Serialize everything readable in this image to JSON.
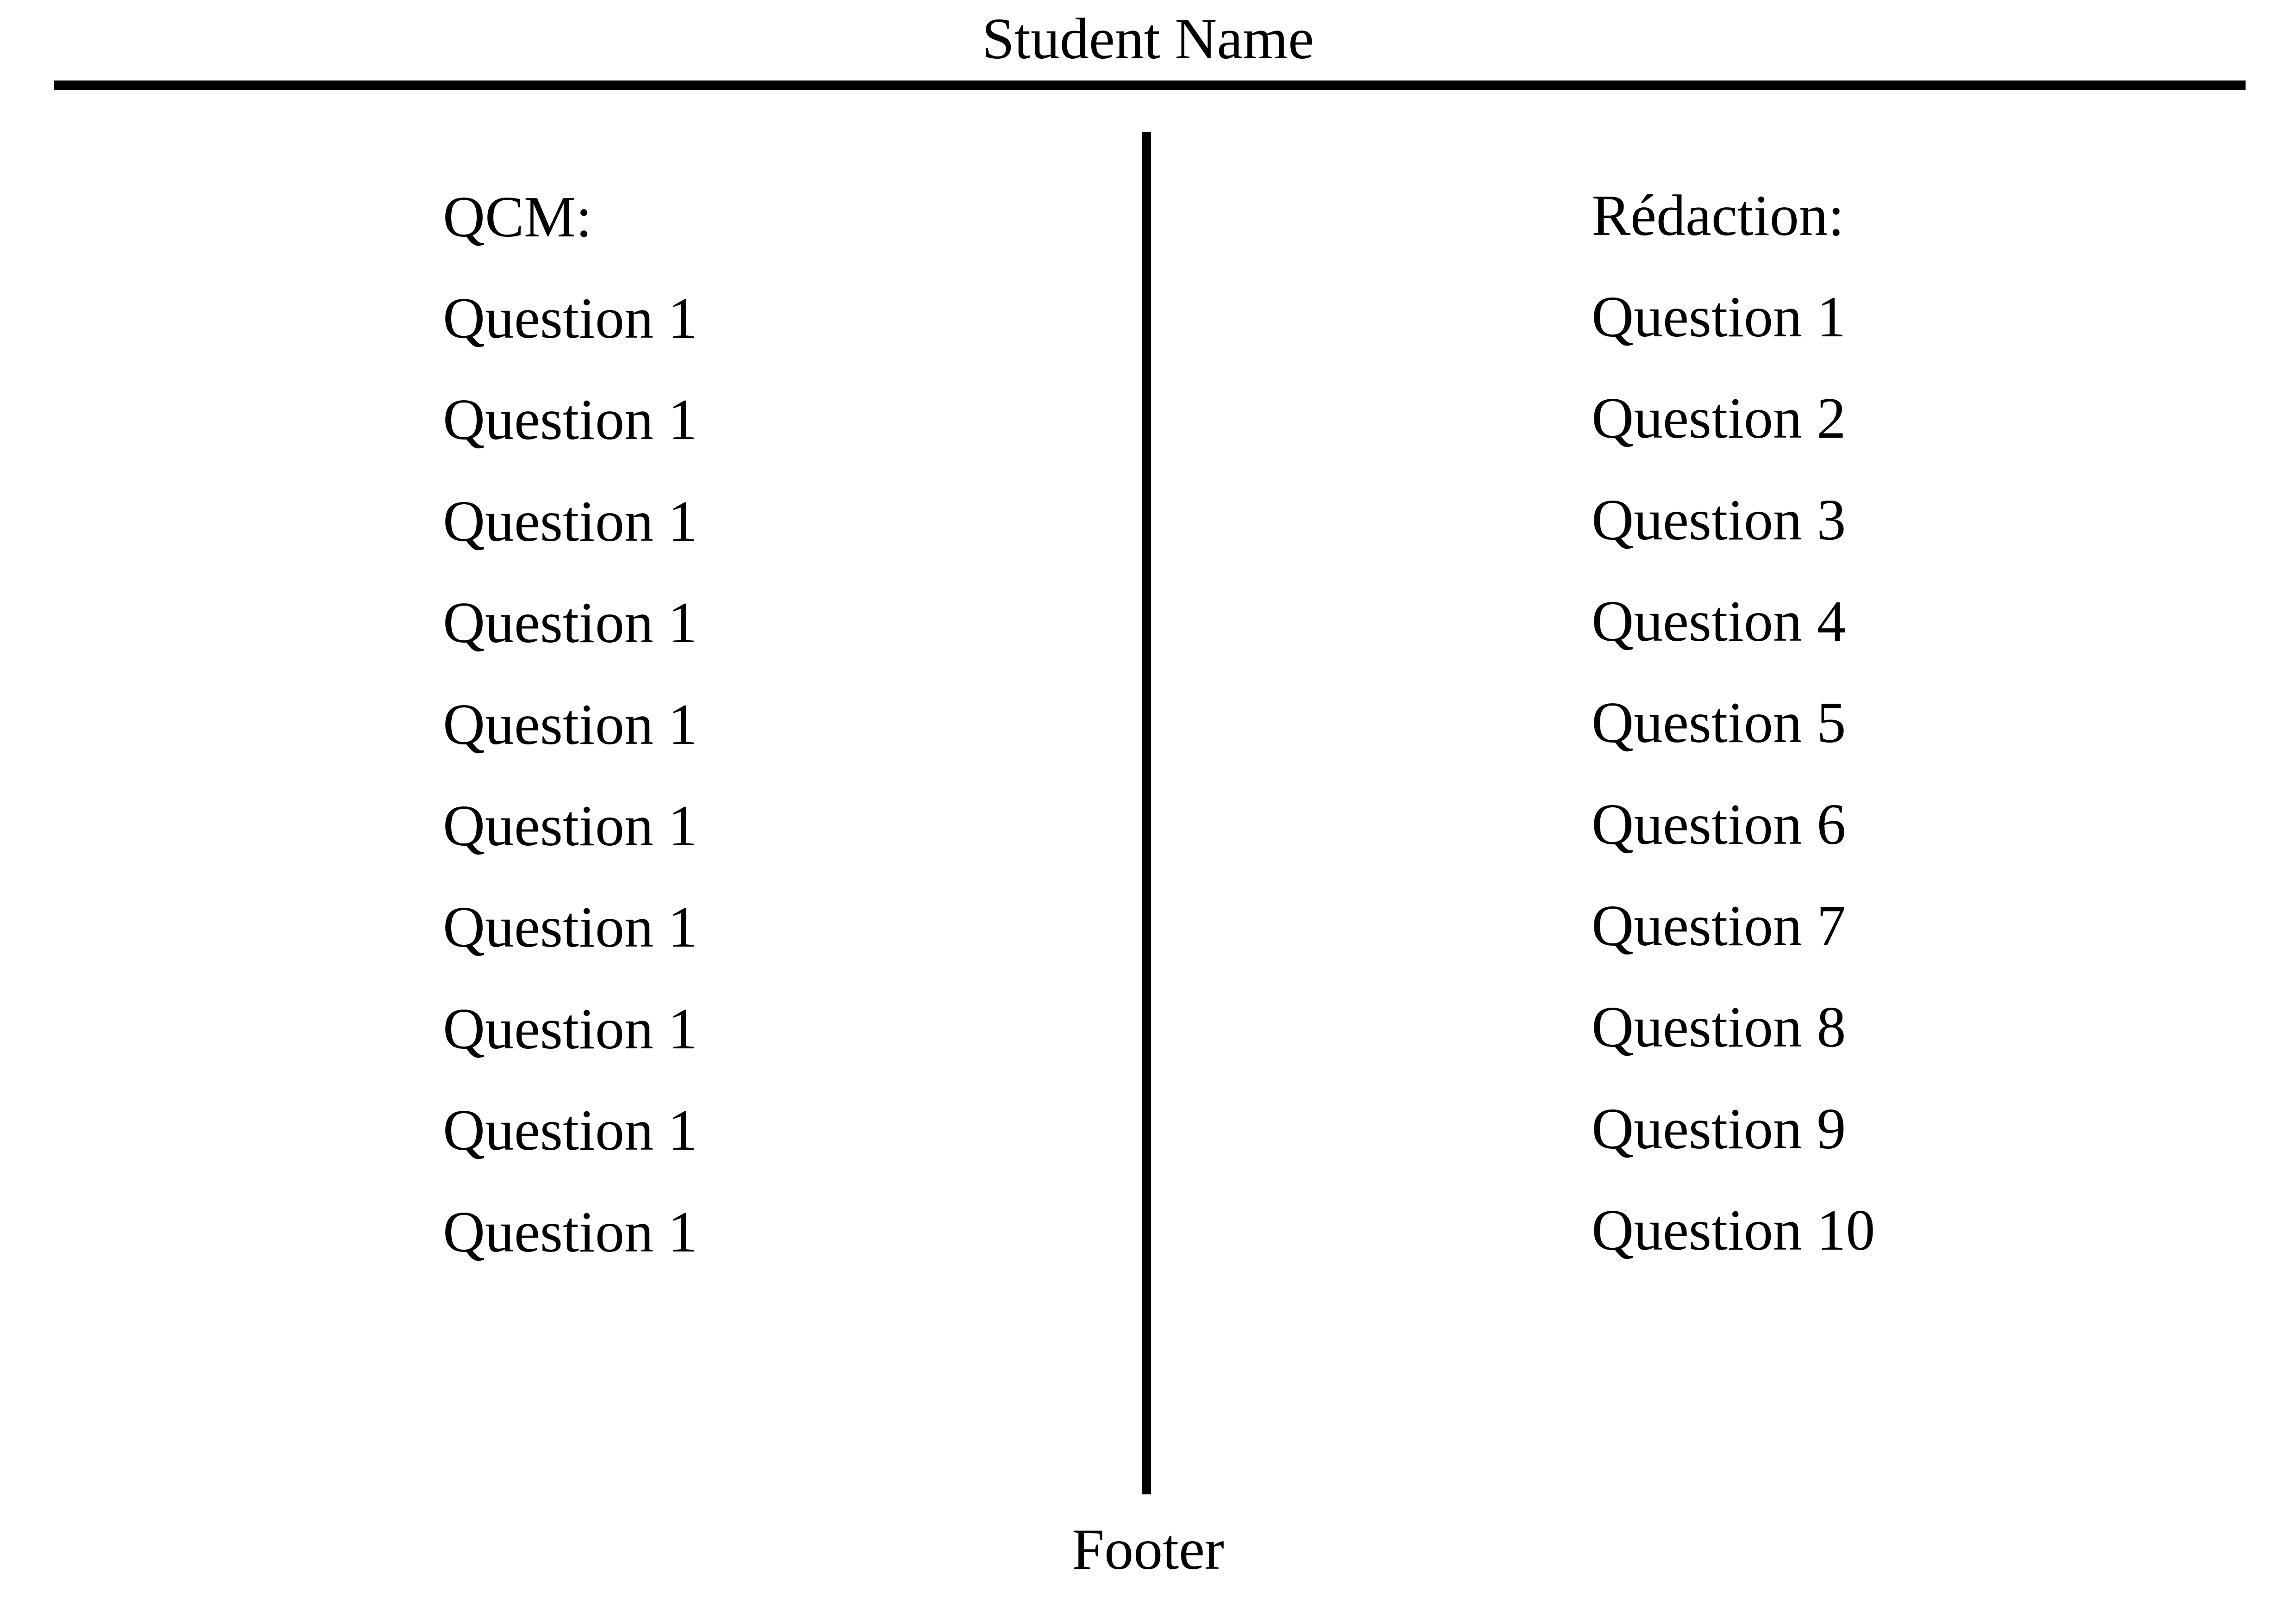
{
  "header": {
    "title": "Student Name"
  },
  "left_column": {
    "heading": "QCM:",
    "items": [
      "Question 1",
      "Question 1",
      "Question 1",
      "Question 1",
      "Question 1",
      "Question 1",
      "Question 1",
      "Question 1",
      "Question 1",
      "Question 1"
    ]
  },
  "right_column": {
    "heading": "Rédaction:",
    "items": [
      "Question 1",
      "Question 2",
      "Question 3",
      "Question 4",
      "Question 5",
      "Question 6",
      "Question 7",
      "Question 8",
      "Question 9",
      "Question 10"
    ]
  },
  "footer": {
    "text": "Footer"
  }
}
